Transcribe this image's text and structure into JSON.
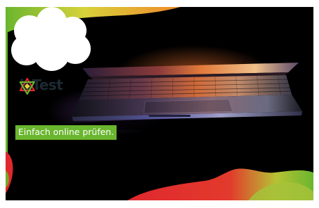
{
  "banner": {
    "brand_name": "isTest",
    "tagline": "Einfach online prüfen.",
    "colors": {
      "background": "#000000",
      "brand_green": "#6ab62e",
      "brand_yellow": "#e6d23a",
      "brand_red": "#e0282e",
      "logo_text": "#1d2a33",
      "cloud": "#ffffff"
    },
    "icons": [
      "hexagram-logo-icon"
    ],
    "image": "laptop-photo"
  }
}
